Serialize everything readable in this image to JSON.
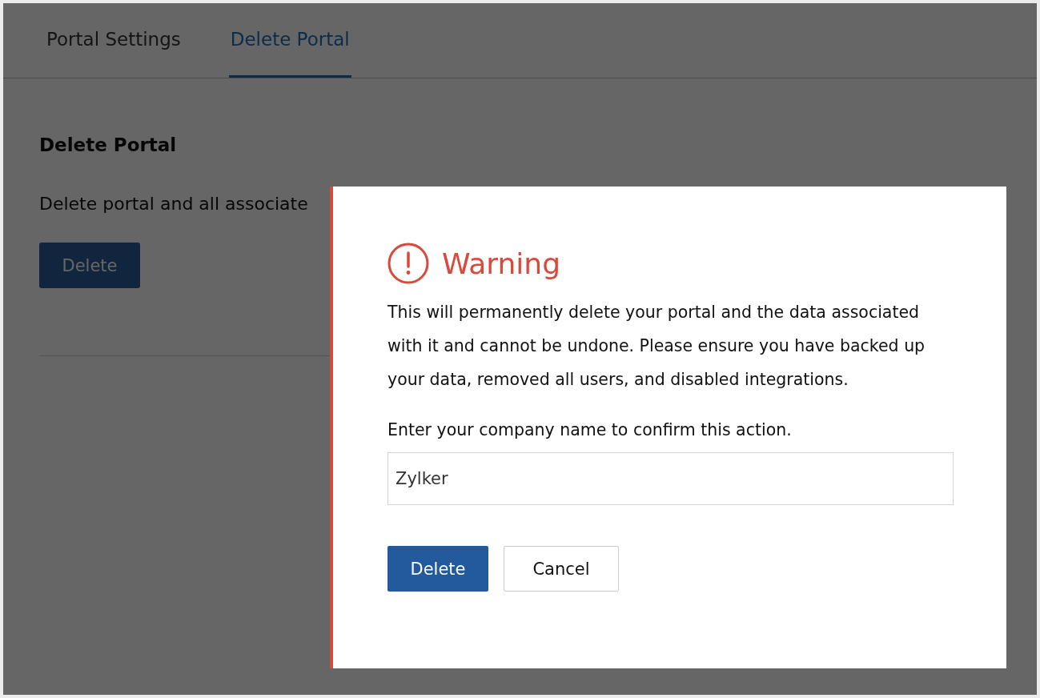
{
  "tabs": [
    {
      "label": "Portal Settings",
      "selected": false
    },
    {
      "label": "Delete Portal",
      "selected": true
    }
  ],
  "section": {
    "title": "Delete Portal",
    "description": "Delete portal and all associate",
    "button": "Delete"
  },
  "dialog": {
    "title": "Warning",
    "message": "This will permanently delete your portal and the data associated with it and cannot be undone. Please ensure you have backed up your data, removed all users, and disabled integrations.",
    "prompt": "Enter your company name to confirm this action.",
    "input": {
      "value": "Zylker"
    },
    "buttons": [
      {
        "label": "Delete",
        "kind": "primary"
      },
      {
        "label": "Cancel",
        "kind": "secondary"
      }
    ]
  }
}
